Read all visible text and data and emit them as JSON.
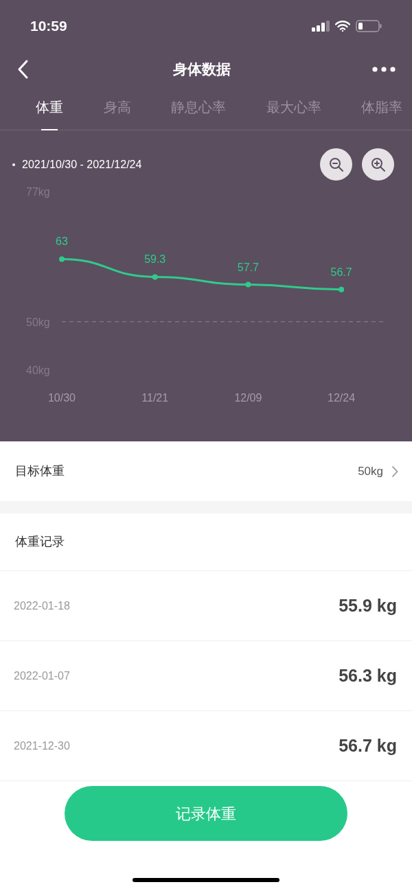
{
  "status_bar": {
    "time": "10:59"
  },
  "header": {
    "title": "身体数据"
  },
  "tabs": [
    {
      "label": "体重",
      "selected": true
    },
    {
      "label": "身高",
      "selected": false
    },
    {
      "label": "静息心率",
      "selected": false
    },
    {
      "label": "最大心率",
      "selected": false
    },
    {
      "label": "体脂率",
      "selected": false
    }
  ],
  "chart": {
    "range": "2021/10/30 - 2021/12/24",
    "chart_data": {
      "type": "line",
      "categories": [
        "10/30",
        "11/21",
        "12/09",
        "12/24"
      ],
      "series": [
        {
          "color": "#2fcb8c",
          "marker": "circle",
          "values": [
            63,
            59.3,
            57.7,
            56.7
          ]
        }
      ],
      "ylim": [
        40,
        77
      ],
      "yticks": [
        {
          "value": 77,
          "label": "77kg"
        },
        {
          "value": 50,
          "label": "50kg"
        },
        {
          "value": 40,
          "label": "40kg"
        }
      ],
      "data_labels": true,
      "ref_lines": [
        {
          "axis": "y",
          "value": 50
        }
      ]
    }
  },
  "target": {
    "label": "目标体重",
    "value": "50kg"
  },
  "records": {
    "title": "体重记录",
    "rows": [
      {
        "date": "2022-01-18",
        "weight": "55.9 kg"
      },
      {
        "date": "2022-01-07",
        "weight": "56.3 kg"
      },
      {
        "date": "2021-12-30",
        "weight": "56.7 kg"
      }
    ]
  },
  "action": {
    "label": "记录体重"
  }
}
